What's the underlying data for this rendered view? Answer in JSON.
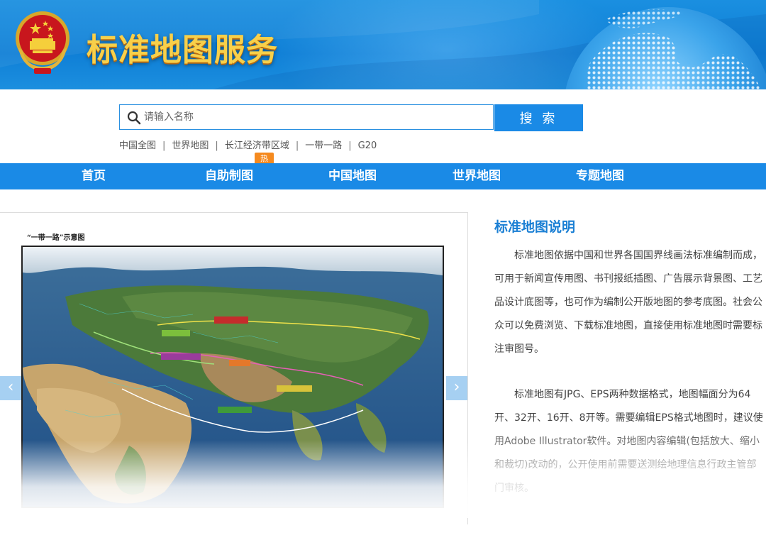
{
  "header": {
    "site_title": "标准地图服务",
    "emblem_icon": "national-emblem-icon",
    "globe_icon": "dotted-globe-icon"
  },
  "search": {
    "placeholder": "请输入名称",
    "value": "",
    "button_label": "搜 索",
    "quick_links": [
      "中国全图",
      "世界地图",
      "长江经济带区域",
      "一带一路",
      "G20"
    ]
  },
  "nav": {
    "items": [
      {
        "label": "首页"
      },
      {
        "label": "自助制图",
        "badge": "热"
      },
      {
        "label": "中国地图"
      },
      {
        "label": "世界地图"
      },
      {
        "label": "专题地图"
      }
    ]
  },
  "carousel": {
    "caption": "“一带一路”示意图",
    "prev_icon": "chevron-left-icon",
    "next_icon": "chevron-right-icon",
    "prev_label": "‹",
    "next_label": "›"
  },
  "description": {
    "title": "标准地图说明",
    "paragraph_1": "标准地图依据中国和世界各国国界线画法标准编制而成，可用于新闻宣传用图、书刊报纸插图、广告展示背景图、工艺品设计底图等，也可作为编制公开版地图的参考底图。社会公众可以免费浏览、下载标准地图，直接使用标准地图时需要标注审图号。",
    "paragraph_2": "标准地图有JPG、EPS两种数据格式，地图幅面分为64开、32开、16开、8开等。需要编辑EPS格式地图时，建议使用Adobe Illustrator软件。对地图内容编辑(包括放大、缩小和裁切)改动的，公开使用前需要送测绘地理信息行政主管部门审核。"
  },
  "colors": {
    "brand_blue": "#1a8ae6",
    "title_gold": "#f8d04a",
    "hot_orange": "#f58a1f",
    "heading_blue": "#1a7fd4"
  }
}
